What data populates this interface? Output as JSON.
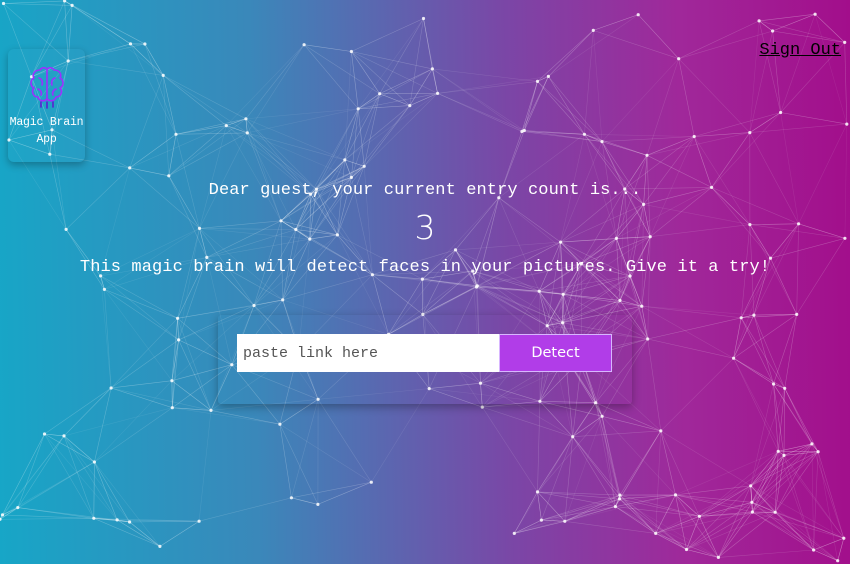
{
  "app": {
    "logo_line1": "Magic Brain",
    "logo_line2": "App",
    "logo_icon": "brain-icon"
  },
  "nav": {
    "sign_out": "Sign Out"
  },
  "main": {
    "greeting": "Dear guest, your current entry count is...",
    "entry_count": "3",
    "tagline": "This magic brain will detect faces in your pictures. Give it a try!"
  },
  "form": {
    "placeholder": "paste link here",
    "value": "",
    "detect_label": "Detect"
  },
  "colors": {
    "gradient_start": "#17a6c7",
    "gradient_end": "#a20e8b",
    "button": "#b13de8",
    "logo_icon": "#9b30ff"
  }
}
